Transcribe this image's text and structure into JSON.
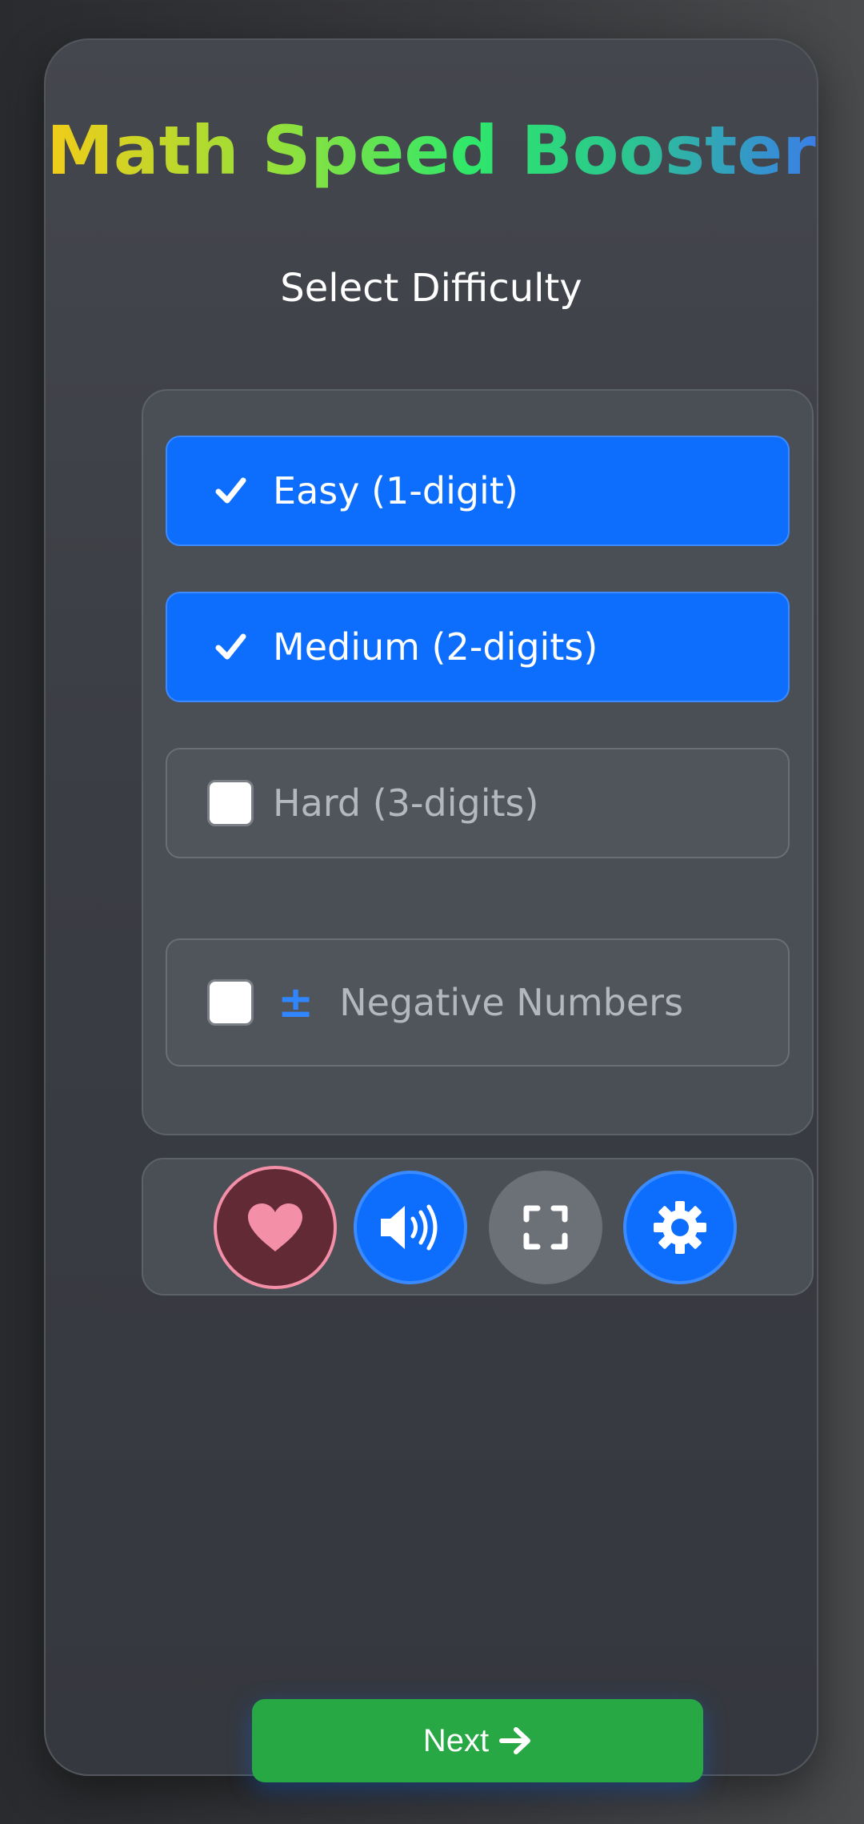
{
  "app": {
    "title": "Math Speed Booster"
  },
  "difficulty": {
    "heading": "Select Difficulty",
    "options": [
      {
        "label": "Easy (1-digit)",
        "checked": true
      },
      {
        "label": "Medium (2-digits)",
        "checked": true
      },
      {
        "label": "Hard (3-digits)",
        "checked": false
      }
    ],
    "negative": {
      "symbol": "±",
      "label": "Negative Numbers",
      "checked": false
    }
  },
  "toolbar": {
    "buttons": [
      {
        "icon": "heart-icon"
      },
      {
        "icon": "volume-icon"
      },
      {
        "icon": "fullscreen-icon"
      },
      {
        "icon": "gear-icon"
      }
    ]
  },
  "footer": {
    "next_label": "Next",
    "next_icon": "arrow-right-icon"
  },
  "colors": {
    "primary": "#0d6efd",
    "success": "#28a745",
    "favorite_bg": "#612a34",
    "favorite_accent": "#f48fa8"
  }
}
